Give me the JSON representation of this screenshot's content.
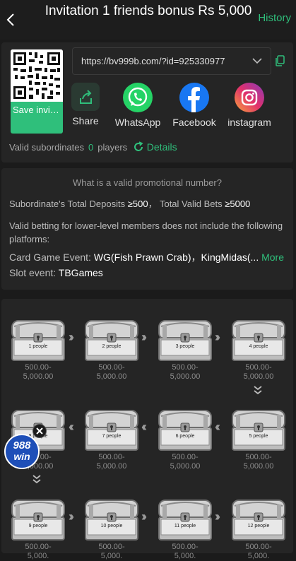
{
  "header": {
    "title": "Invitation 1 friends bonus Rs 5,000",
    "history_label": "History"
  },
  "invite": {
    "qr_save_label": "Save invitation...",
    "link": "https://bv999b.com/?id=925330977",
    "share_items": [
      {
        "icon": "share-icon",
        "label": "Share",
        "color": "#2fbf7b"
      },
      {
        "icon": "whatsapp-icon",
        "label": "WhatsApp",
        "color": "#25d366"
      },
      {
        "icon": "facebook-icon",
        "label": "Facebook",
        "color": "#1877f2"
      },
      {
        "icon": "instagram-icon",
        "label": "instagram",
        "color": "#e1306c"
      }
    ],
    "valid_sub_label": "Valid subordinates",
    "valid_sub_count": "0",
    "valid_sub_unit": "players",
    "details_label": "Details"
  },
  "promo": {
    "question": "What is a valid promotional number?",
    "deposit_label": "Subordinate's Total Deposits",
    "deposit_value": "≥500",
    "bets_label": "Total Valid Bets",
    "bets_value": "≥5000",
    "note": "Valid betting for lower-level members does not include the following platforms:",
    "card_label": "Card Game Event:",
    "card_value": "WG(Fish Prawn Crab)，KingMidas(...",
    "more_label": "More",
    "slot_label": "Slot event:",
    "slot_value": "TBGames"
  },
  "chests": [
    {
      "people": "1 people",
      "range": "500.00-5,000.00"
    },
    {
      "people": "2 people",
      "range": "500.00-5,000.00"
    },
    {
      "people": "3 people",
      "range": "500.00-5,000.00"
    },
    {
      "people": "4 people",
      "range": "500.00-5,000.00"
    },
    {
      "people": "5 people",
      "range": "500.00-5,000.00"
    },
    {
      "people": "6 people",
      "range": "500.00-5,000.00"
    },
    {
      "people": "7 people",
      "range": "500.00-5,000.00"
    },
    {
      "people": "8 people",
      "range": "500.00-5,000.00"
    },
    {
      "people": "9 people",
      "range": "500.00-5,000."
    },
    {
      "people": "10 people",
      "range": "500.00-5,000."
    },
    {
      "people": "11 people",
      "range": "500.00-5,000."
    },
    {
      "people": "12 people",
      "range": "500.00-5,000."
    }
  ],
  "float_ad": {
    "line1": "988",
    "line2": "win"
  },
  "colors": {
    "accent": "#2fbf7b",
    "background": "#1b1b1b",
    "card": "#252525"
  }
}
